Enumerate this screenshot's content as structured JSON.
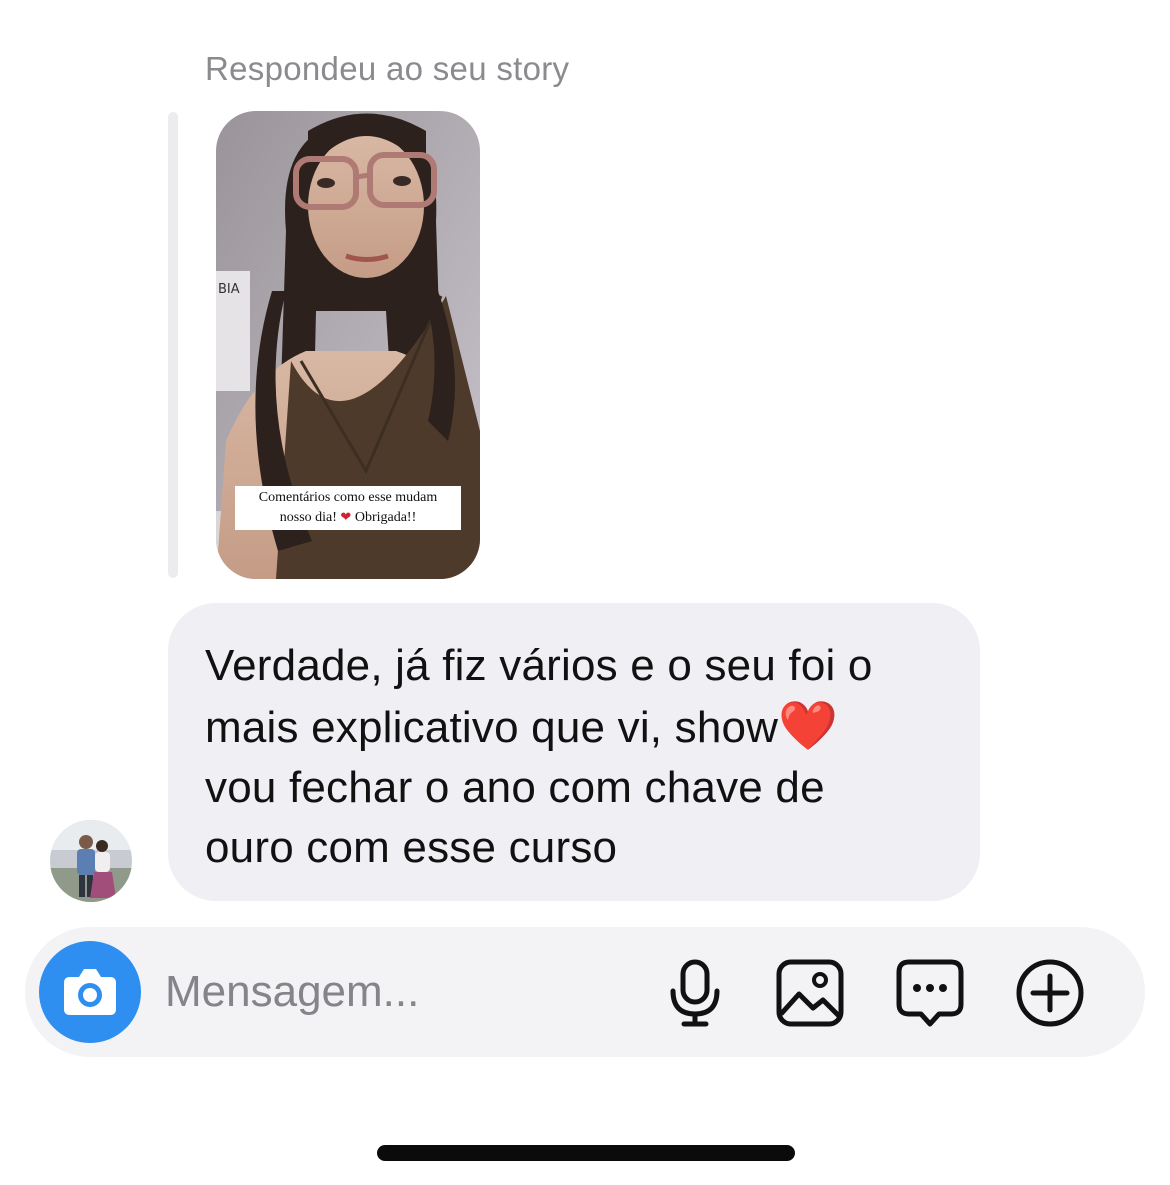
{
  "thread": {
    "reply_context": "Respondeu ao seu story",
    "story": {
      "caption_lines": [
        "Comentários como esse mudam",
        "nosso dia!"
      ],
      "caption_after_heart": "Obrigada!!",
      "heart": "❤",
      "overlay_fragment": "BIA"
    },
    "message": {
      "lines": [
        "Verdade, já fiz vários e o seu foi o",
        "mais explicativo que vi, show",
        "vou fechar o ano com chave de",
        "ouro com esse curso"
      ],
      "emoji": "❤️"
    }
  },
  "composer": {
    "placeholder": "Mensagem...",
    "actions": [
      "camera-icon",
      "microphone-icon",
      "gallery-icon",
      "sticker-chat-icon",
      "plus-circle-icon"
    ]
  },
  "colors": {
    "camera_button": "#2f8ff0",
    "bubble": "#efeff4",
    "composer": "#f3f3f6"
  }
}
